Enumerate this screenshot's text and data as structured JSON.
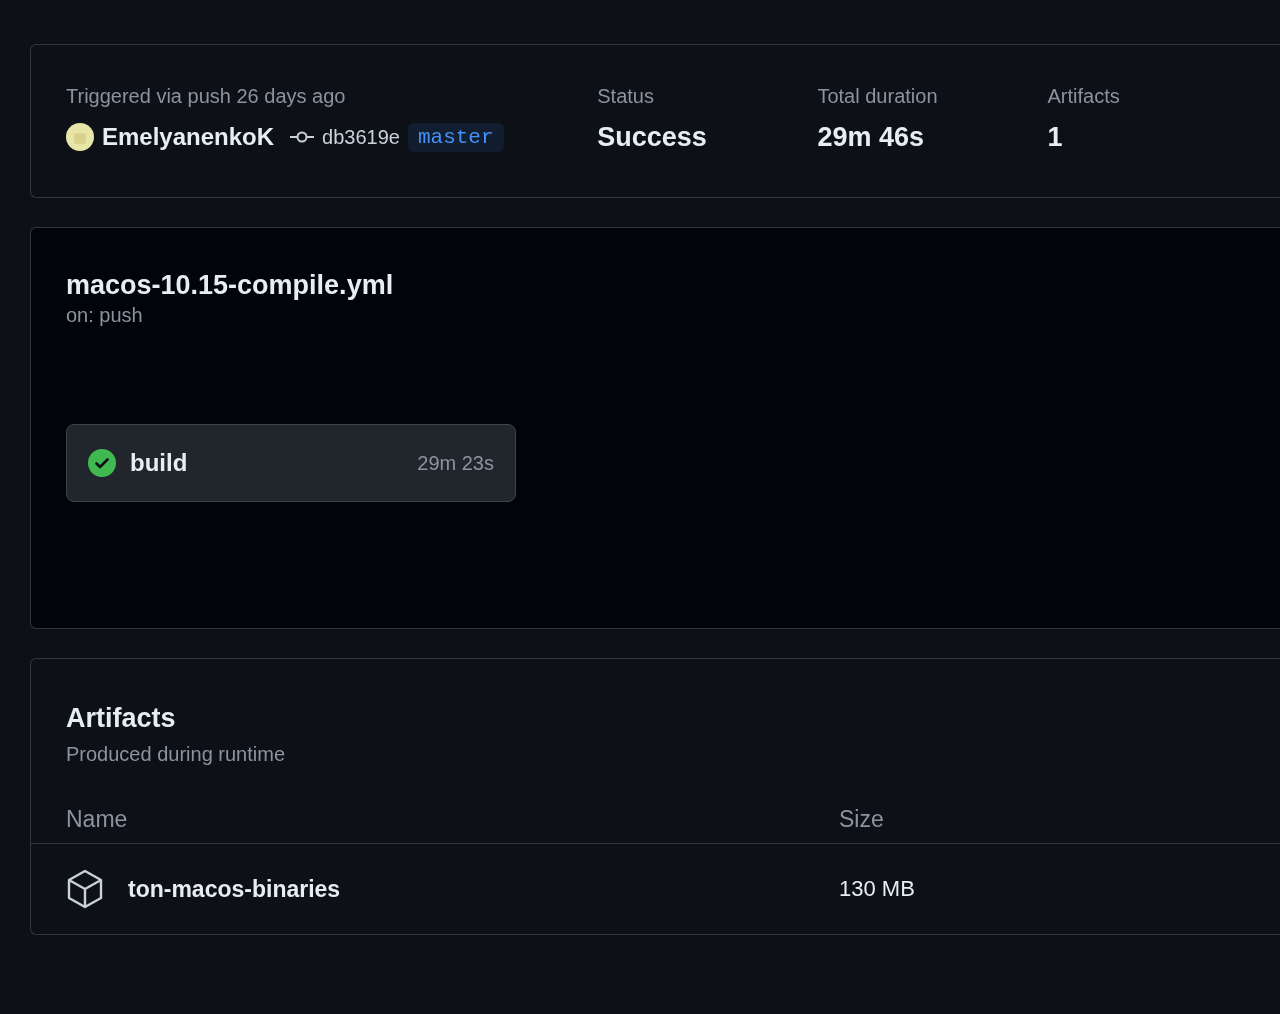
{
  "summary": {
    "trigger": "Triggered via push 26 days ago",
    "actor": "EmelyanenkoK",
    "commit": "db3619e",
    "branch": "master",
    "stats": [
      {
        "label": "Status",
        "value": "Success"
      },
      {
        "label": "Total duration",
        "value": "29m 46s"
      },
      {
        "label": "Artifacts",
        "value": "1"
      }
    ]
  },
  "workflow": {
    "file": "macos-10.15-compile.yml",
    "event": "on: push",
    "jobs": [
      {
        "name": "build",
        "succeeded": true,
        "duration": "29m 23s"
      }
    ]
  },
  "artifacts": {
    "title": "Artifacts",
    "subtitle": "Produced during runtime",
    "columns": [
      "Name",
      "Size"
    ],
    "rows": [
      {
        "name": "ton-macos-binaries",
        "size": "130 MB"
      }
    ]
  }
}
